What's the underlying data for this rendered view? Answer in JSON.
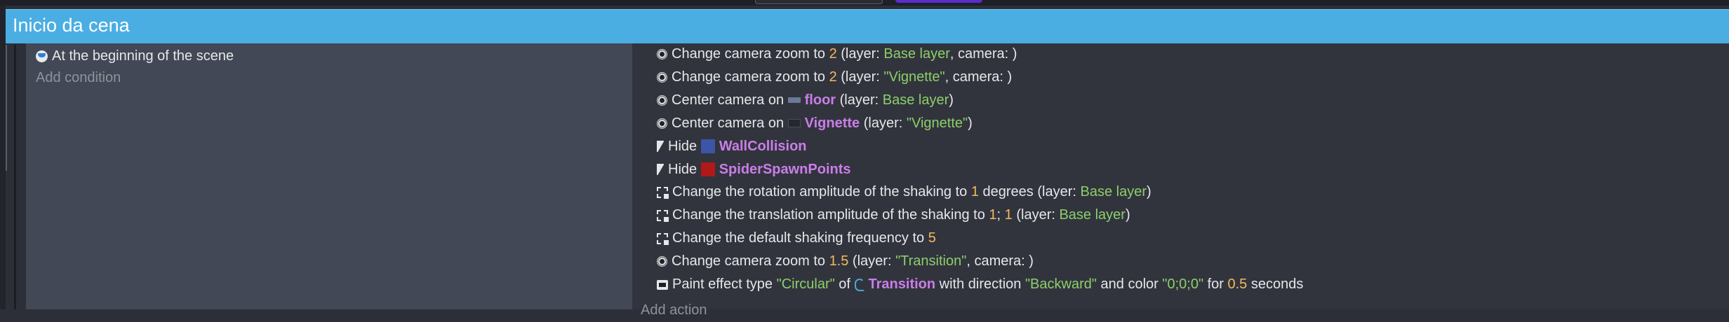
{
  "group": {
    "title": "Inicio da cena"
  },
  "conditions": {
    "items": [
      {
        "icon": "scene-start-icon",
        "text": "At the beginning of the scene"
      }
    ],
    "add_label": "Add condition"
  },
  "actions": {
    "items": [
      {
        "icon": "camera-icon",
        "segments": [
          {
            "t": "Change camera zoom to "
          },
          {
            "t": "2",
            "k": "num"
          },
          {
            "t": " (layer: "
          },
          {
            "t": "Base layer",
            "k": "str"
          },
          {
            "t": ", camera: )"
          }
        ]
      },
      {
        "icon": "camera-icon",
        "segments": [
          {
            "t": "Change camera zoom to "
          },
          {
            "t": "2",
            "k": "num"
          },
          {
            "t": " (layer: "
          },
          {
            "t": "\"Vignette\"",
            "k": "str"
          },
          {
            "t": ", camera: )"
          }
        ]
      },
      {
        "icon": "camera-icon",
        "segments": [
          {
            "t": "Center camera on "
          },
          {
            "obj_icon": "floor-thumbnail-icon"
          },
          {
            "t": "floor",
            "k": "obj"
          },
          {
            "t": " (layer: "
          },
          {
            "t": "Base layer",
            "k": "str"
          },
          {
            "t": ")"
          }
        ]
      },
      {
        "icon": "camera-icon",
        "segments": [
          {
            "t": "Center camera on "
          },
          {
            "obj_icon": "vignette-thumbnail-icon"
          },
          {
            "t": "Vignette",
            "k": "obj"
          },
          {
            "t": " (layer: "
          },
          {
            "t": "\"Vignette\"",
            "k": "str"
          },
          {
            "t": ")"
          }
        ]
      },
      {
        "icon": "hide-icon",
        "segments": [
          {
            "t": "Hide "
          },
          {
            "obj_icon": "wallcollision-thumbnail-icon"
          },
          {
            "t": "WallCollision",
            "k": "obj"
          }
        ]
      },
      {
        "icon": "hide-icon",
        "segments": [
          {
            "t": "Hide "
          },
          {
            "obj_icon": "spiderspawnpoints-thumbnail-icon"
          },
          {
            "t": "SpiderSpawnPoints",
            "k": "obj"
          }
        ]
      },
      {
        "icon": "shake-icon",
        "segments": [
          {
            "t": "Change the rotation amplitude of the shaking to "
          },
          {
            "t": "1",
            "k": "num"
          },
          {
            "t": " degrees (layer: "
          },
          {
            "t": "Base layer",
            "k": "str"
          },
          {
            "t": ")"
          }
        ]
      },
      {
        "icon": "shake-icon",
        "segments": [
          {
            "t": "Change the translation amplitude of the shaking to "
          },
          {
            "t": "1",
            "k": "num"
          },
          {
            "t": "; "
          },
          {
            "t": "1",
            "k": "num"
          },
          {
            "t": " (layer: "
          },
          {
            "t": "Base layer",
            "k": "str"
          },
          {
            "t": ")"
          }
        ]
      },
      {
        "icon": "shake-icon",
        "segments": [
          {
            "t": "Change the default shaking frequency to "
          },
          {
            "t": "5",
            "k": "num"
          }
        ]
      },
      {
        "icon": "camera-icon",
        "segments": [
          {
            "t": "Change camera zoom to "
          },
          {
            "t": "1.5",
            "k": "num"
          },
          {
            "t": " (layer: "
          },
          {
            "t": "\"Transition\"",
            "k": "str"
          },
          {
            "t": ", camera: )"
          }
        ]
      },
      {
        "icon": "paint-effect-icon",
        "segments": [
          {
            "t": "Paint effect type "
          },
          {
            "t": "\"Circular\"",
            "k": "str"
          },
          {
            "t": " of "
          },
          {
            "obj_icon": "transition-thumbnail-icon"
          },
          {
            "t": "Transition",
            "k": "obj"
          },
          {
            "t": " with direction "
          },
          {
            "t": "\"Backward\"",
            "k": "str"
          },
          {
            "t": " and color "
          },
          {
            "t": "\"0;0;0\"",
            "k": "str"
          },
          {
            "t": " for "
          },
          {
            "t": "0.5",
            "k": "num"
          },
          {
            "t": " seconds"
          }
        ]
      }
    ],
    "add_label": "Add action"
  }
}
